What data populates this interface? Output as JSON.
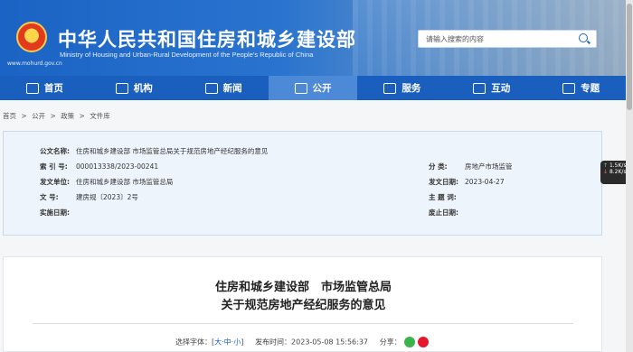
{
  "header": {
    "title": "中华人民共和国住房和城乡建设部",
    "subtitle": "Ministry of Housing and Urban-Rural Development of the People’s Republic of China",
    "url": "www.mohurd.gov.cn",
    "search_placeholder": "请输入搜索的内容"
  },
  "nav": [
    {
      "label": "首页",
      "icon": "home-icon"
    },
    {
      "label": "机构",
      "icon": "building-icon"
    },
    {
      "label": "新闻",
      "icon": "news-icon"
    },
    {
      "label": "公开",
      "icon": "open-icon",
      "active": true
    },
    {
      "label": "服务",
      "icon": "service-icon"
    },
    {
      "label": "互动",
      "icon": "interact-icon"
    },
    {
      "label": "专题",
      "icon": "topic-icon"
    }
  ],
  "breadcrumb": [
    "首页",
    ">",
    "公开",
    ">",
    "政策",
    ">",
    "文件库"
  ],
  "info": {
    "title_label": "公文名称:",
    "title_value": "住房和城乡建设部 市场监管总局关于规范房地产经纪服务的意见",
    "index_label": "索 引 号:",
    "index_value": "000013338/2023-00241",
    "category_label": "分 类:",
    "category_value": "房地产市场监管",
    "issuer_label": "发文单位:",
    "issuer_value": "住房和城乡建设部 市场监管总局",
    "date_label": "发文日期:",
    "date_value": "2023-04-27",
    "docno_label": "文 号:",
    "docno_value": "建房规〔2023〕2号",
    "subject_label": "主 题 词:",
    "subject_value": "",
    "effective_label": "实施日期:",
    "effective_value": "",
    "expiry_label": "废止日期:",
    "expiry_value": ""
  },
  "widget": {
    "up": "1.5",
    "up_unit": "K/s",
    "down": "8.2",
    "down_unit": "K/s"
  },
  "article": {
    "title_line1": "住房和城乡建设部　市场监管总局",
    "title_line2": "关于规范房地产经纪服务的意见",
    "font_label": "选择字体：[",
    "font_large": "大",
    "font_medium": "中",
    "font_small": "小",
    "font_end": "]",
    "publish_time": "发布时间：2023-05-08 15:56:37",
    "share_label": "分享："
  }
}
